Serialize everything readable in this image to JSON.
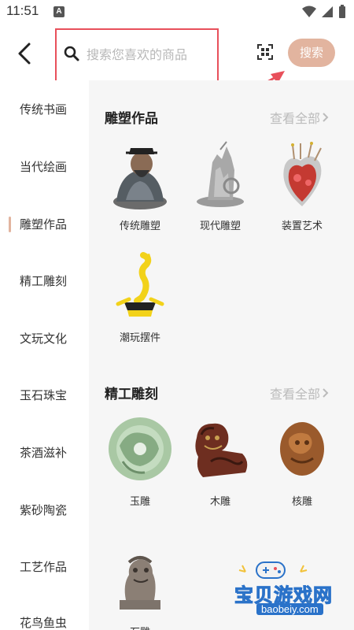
{
  "status_bar": {
    "time": "11:51",
    "a_badge": "A"
  },
  "search": {
    "placeholder": "搜索您喜欢的商品",
    "button_label": "搜索"
  },
  "sidebar": {
    "items": [
      {
        "label": "传统书画"
      },
      {
        "label": "当代绘画"
      },
      {
        "label": "雕塑作品",
        "active": true
      },
      {
        "label": "精工雕刻"
      },
      {
        "label": "文玩文化"
      },
      {
        "label": "玉石珠宝"
      },
      {
        "label": "茶酒滋补"
      },
      {
        "label": "紫砂陶瓷"
      },
      {
        "label": "工艺作品"
      },
      {
        "label": "花鸟鱼虫"
      }
    ]
  },
  "sections": [
    {
      "title": "雕塑作品",
      "view_all": "查看全部",
      "items": [
        {
          "label": "传统雕塑",
          "icon": "traditional-sculpture-image"
        },
        {
          "label": "现代雕塑",
          "icon": "modern-sculpture-image"
        },
        {
          "label": "装置艺术",
          "icon": "installation-art-image"
        },
        {
          "label": "潮玩摆件",
          "icon": "trendy-toy-image"
        }
      ]
    },
    {
      "title": "精工雕刻",
      "view_all": "查看全部",
      "items": [
        {
          "label": "玉雕",
          "icon": "jade-carving-image"
        },
        {
          "label": "木雕",
          "icon": "wood-carving-image"
        },
        {
          "label": "核雕",
          "icon": "nut-carving-image"
        },
        {
          "label": "石雕",
          "icon": "stone-carving-image"
        }
      ]
    }
  ],
  "watermark": {
    "title": "宝贝游戏网",
    "url": "baobeiy.com"
  },
  "colors": {
    "accent": "#e2b49f",
    "highlight": "#e8505b",
    "content_bg": "#f6f6f6"
  }
}
